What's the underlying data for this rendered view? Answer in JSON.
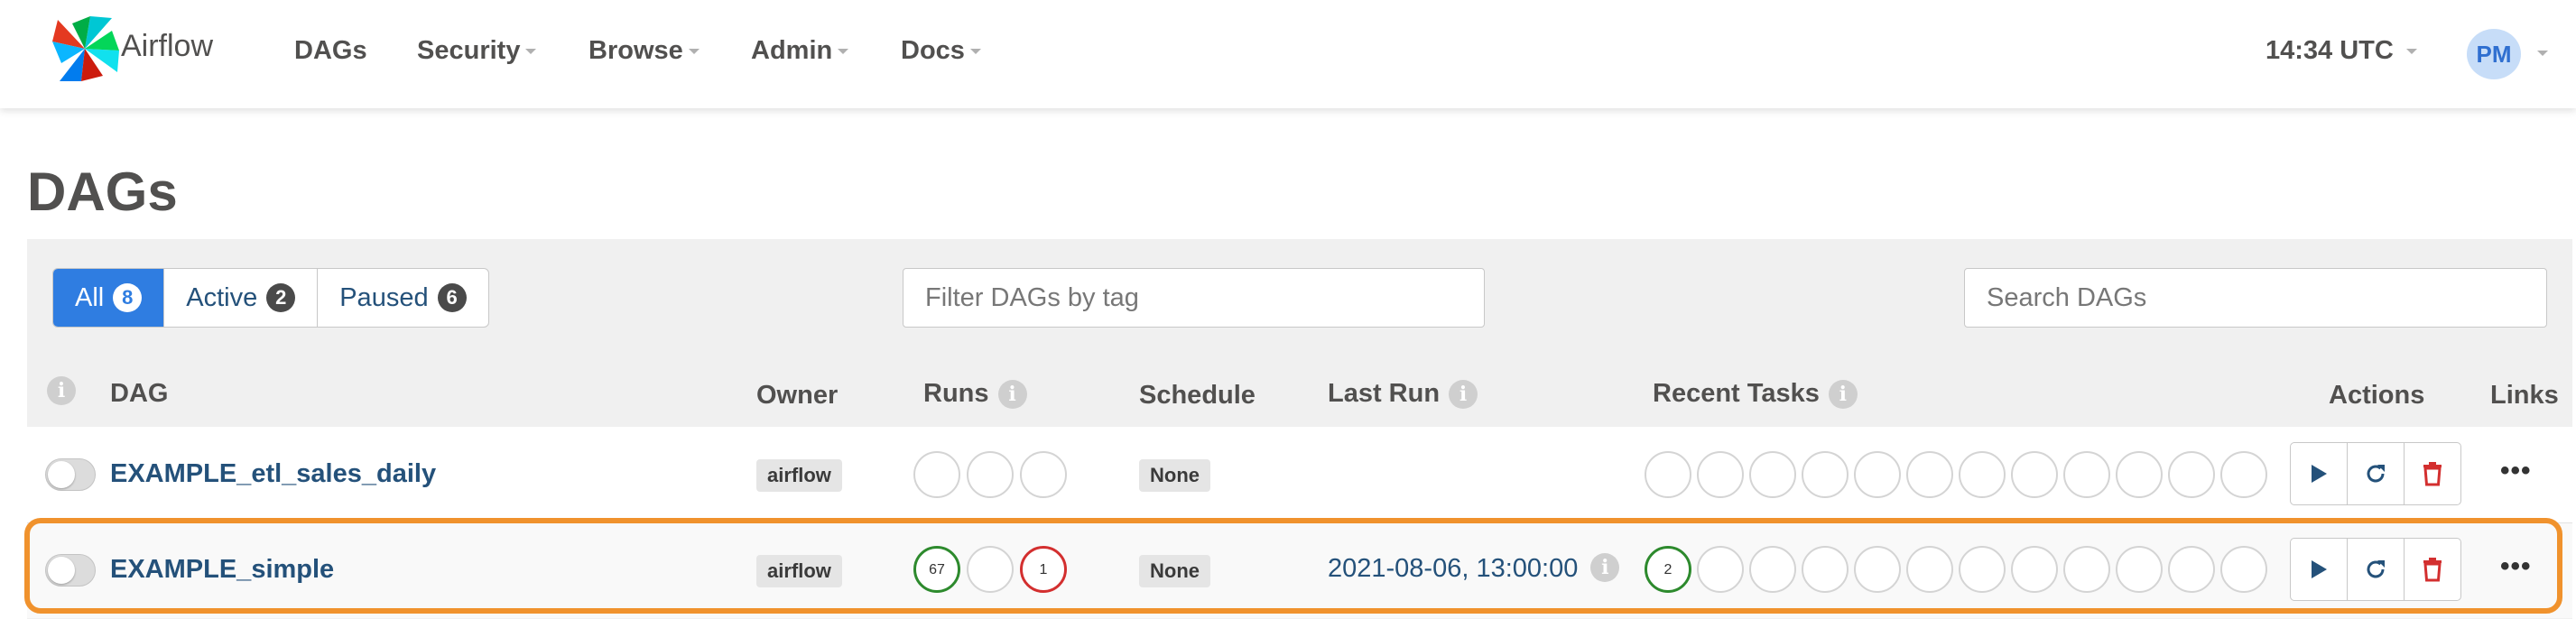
{
  "navbar": {
    "brand": "Airflow",
    "items": [
      {
        "label": "DAGs",
        "has_caret": false
      },
      {
        "label": "Security",
        "has_caret": true
      },
      {
        "label": "Browse",
        "has_caret": true
      },
      {
        "label": "Admin",
        "has_caret": true
      },
      {
        "label": "Docs",
        "has_caret": true
      }
    ],
    "clock": "14:34 UTC",
    "avatar_initials": "PM"
  },
  "page": {
    "title": "DAGs"
  },
  "filters": {
    "status_tabs": [
      {
        "label": "All",
        "count": "8",
        "active": true
      },
      {
        "label": "Active",
        "count": "2",
        "active": false
      },
      {
        "label": "Paused",
        "count": "6",
        "active": false
      }
    ],
    "tag_placeholder": "Filter DAGs by tag",
    "search_placeholder": "Search DAGs"
  },
  "table": {
    "headers": {
      "dag": "DAG",
      "owner": "Owner",
      "runs": "Runs",
      "schedule": "Schedule",
      "last_run": "Last Run",
      "recent_tasks": "Recent Tasks",
      "actions": "Actions",
      "links": "Links"
    },
    "rows": [
      {
        "dag_id": "EXAMPLE_etl_sales_daily",
        "owner": "airflow",
        "schedule": "None",
        "last_run": "",
        "runs": [
          "",
          "",
          ""
        ],
        "recent_tasks": [
          "",
          "",
          "",
          "",
          "",
          "",
          "",
          "",
          "",
          "",
          "",
          ""
        ]
      },
      {
        "dag_id": "EXAMPLE_simple",
        "owner": "airflow",
        "schedule": "None",
        "last_run": "2021-08-06, 13:00:00",
        "runs": [
          "67",
          "",
          "1"
        ],
        "recent_tasks": [
          "2",
          "",
          "",
          "",
          "",
          "",
          "",
          "",
          "",
          "",
          "",
          ""
        ]
      }
    ],
    "links_menu": "•••"
  },
  "colors": {
    "accent": "#2f7de1",
    "link": "#24517a",
    "success": "#2d8a2d",
    "failed": "#d32f2f",
    "highlight": "#f0922d"
  }
}
